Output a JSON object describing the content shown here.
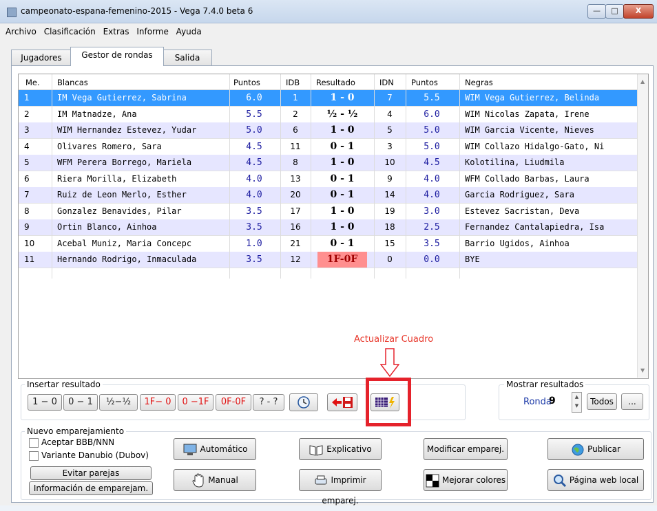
{
  "window": {
    "title": "campeonato-espana-femenino-2015 - Vega 7.4.0 beta 6",
    "controls": {
      "minimize": "—",
      "maximize": "□",
      "close": "X"
    }
  },
  "menu": [
    "Archivo",
    "Clasificación",
    "Extras",
    "Informe",
    "Ayuda"
  ],
  "tabs": [
    "Jugadores",
    "Gestor de rondas",
    "Salida"
  ],
  "active_tab": "Gestor de rondas",
  "table": {
    "headers": {
      "me": "Me.",
      "blancas": "Blancas",
      "puntos_w": "Puntos",
      "idb": "IDB",
      "resultado": "Resultado",
      "idn": "IDN",
      "puntos_b": "Puntos",
      "negras": "Negras"
    },
    "rows": [
      {
        "me": "1",
        "white": "IM Vega Gutierrez, Sabrina",
        "wpts": "6.0",
        "idb": "1",
        "result": "1 - 0",
        "idn": "7",
        "bpts": "5.5",
        "black": "WIM Vega Gutierrez, Belinda",
        "selected": true
      },
      {
        "me": "2",
        "white": "IM Matnadze, Ana",
        "wpts": "5.5",
        "idb": "2",
        "result": "½ - ½",
        "idn": "4",
        "bpts": "6.0",
        "black": "WIM Nicolas Zapata, Irene"
      },
      {
        "me": "3",
        "white": "WIM Hernandez Estevez, Yudar",
        "wpts": "5.0",
        "idb": "6",
        "result": "1 - 0",
        "idn": "5",
        "bpts": "5.0",
        "black": "WIM Garcia Vicente, Nieves"
      },
      {
        "me": "4",
        "white": "Olivares Romero, Sara",
        "wpts": "4.5",
        "idb": "11",
        "result": "0 - 1",
        "idn": "3",
        "bpts": "5.0",
        "black": "WIM Collazo Hidalgo-Gato, Ni"
      },
      {
        "me": "5",
        "white": "WFM Perera Borrego, Mariela",
        "wpts": "4.5",
        "idb": "8",
        "result": "1 - 0",
        "idn": "10",
        "bpts": "4.5",
        "black": "Kolotilina, Liudmila"
      },
      {
        "me": "6",
        "white": "Riera Morilla, Elizabeth",
        "wpts": "4.0",
        "idb": "13",
        "result": "0 - 1",
        "idn": "9",
        "bpts": "4.0",
        "black": "WFM Collado Barbas, Laura"
      },
      {
        "me": "7",
        "white": "Ruiz de Leon Merlo, Esther",
        "wpts": "4.0",
        "idb": "20",
        "result": "0 - 1",
        "idn": "14",
        "bpts": "4.0",
        "black": "Garcia Rodriguez, Sara"
      },
      {
        "me": "8",
        "white": "Gonzalez Benavides, Pilar",
        "wpts": "3.5",
        "idb": "17",
        "result": "1 - 0",
        "idn": "19",
        "bpts": "3.0",
        "black": "Estevez Sacristan, Deva"
      },
      {
        "me": "9",
        "white": "Ortin Blanco, Ainhoa",
        "wpts": "3.5",
        "idb": "16",
        "result": "1 - 0",
        "idn": "18",
        "bpts": "2.5",
        "black": "Fernandez Cantalapiedra, Isa"
      },
      {
        "me": "10",
        "white": "Acebal Muniz, Maria Concepc",
        "wpts": "1.0",
        "idb": "21",
        "result": "0 - 1",
        "idn": "15",
        "bpts": "3.5",
        "black": "Barrio Ugidos, Ainhoa"
      },
      {
        "me": "11",
        "white": "Hernando Rodrigo, Inmaculada",
        "wpts": "3.5",
        "idb": "12",
        "result": "1F-0F",
        "idn": "0",
        "bpts": "0.0",
        "black": "BYE",
        "forfeit": true
      }
    ]
  },
  "annotation": {
    "label": "Actualizar Cuadro",
    "color": "#e5222b"
  },
  "insert_result": {
    "label": "Insertar resultado",
    "buttons": [
      "1 − 0",
      "0 − 1",
      "½−½",
      "1F− 0",
      "0 −1F",
      "0F-0F",
      "? - ?"
    ],
    "icon_buttons": [
      "clock-icon",
      "delete-result-icon",
      "update-table-icon"
    ]
  },
  "show_results": {
    "label": "Mostrar resultados",
    "round_label": "Ronda",
    "round_value": "9",
    "all_button": "Todos",
    "more_button": "..."
  },
  "pairing": {
    "label": "Nuevo emparejamiento",
    "checkboxes": [
      "Aceptar BBB/NNN",
      "Variante Danubio (Dubov)"
    ],
    "small_buttons": [
      "Evitar parejas",
      "Información de emparejam."
    ],
    "buttons": {
      "automatico": "Automático",
      "explicativo": "Explicativo",
      "modificar": "Modificar emparej.",
      "publicar": "Publicar",
      "manual": "Manual",
      "imprimir": "Imprimir emparej.",
      "mejorar": "Mejorar colores",
      "pagina": "Página web local"
    }
  },
  "colors": {
    "selected_row": "#3399ff",
    "alt_row": "#e6e6ff",
    "forfeit": "#ff8f8f",
    "result_red": "#e01010"
  }
}
